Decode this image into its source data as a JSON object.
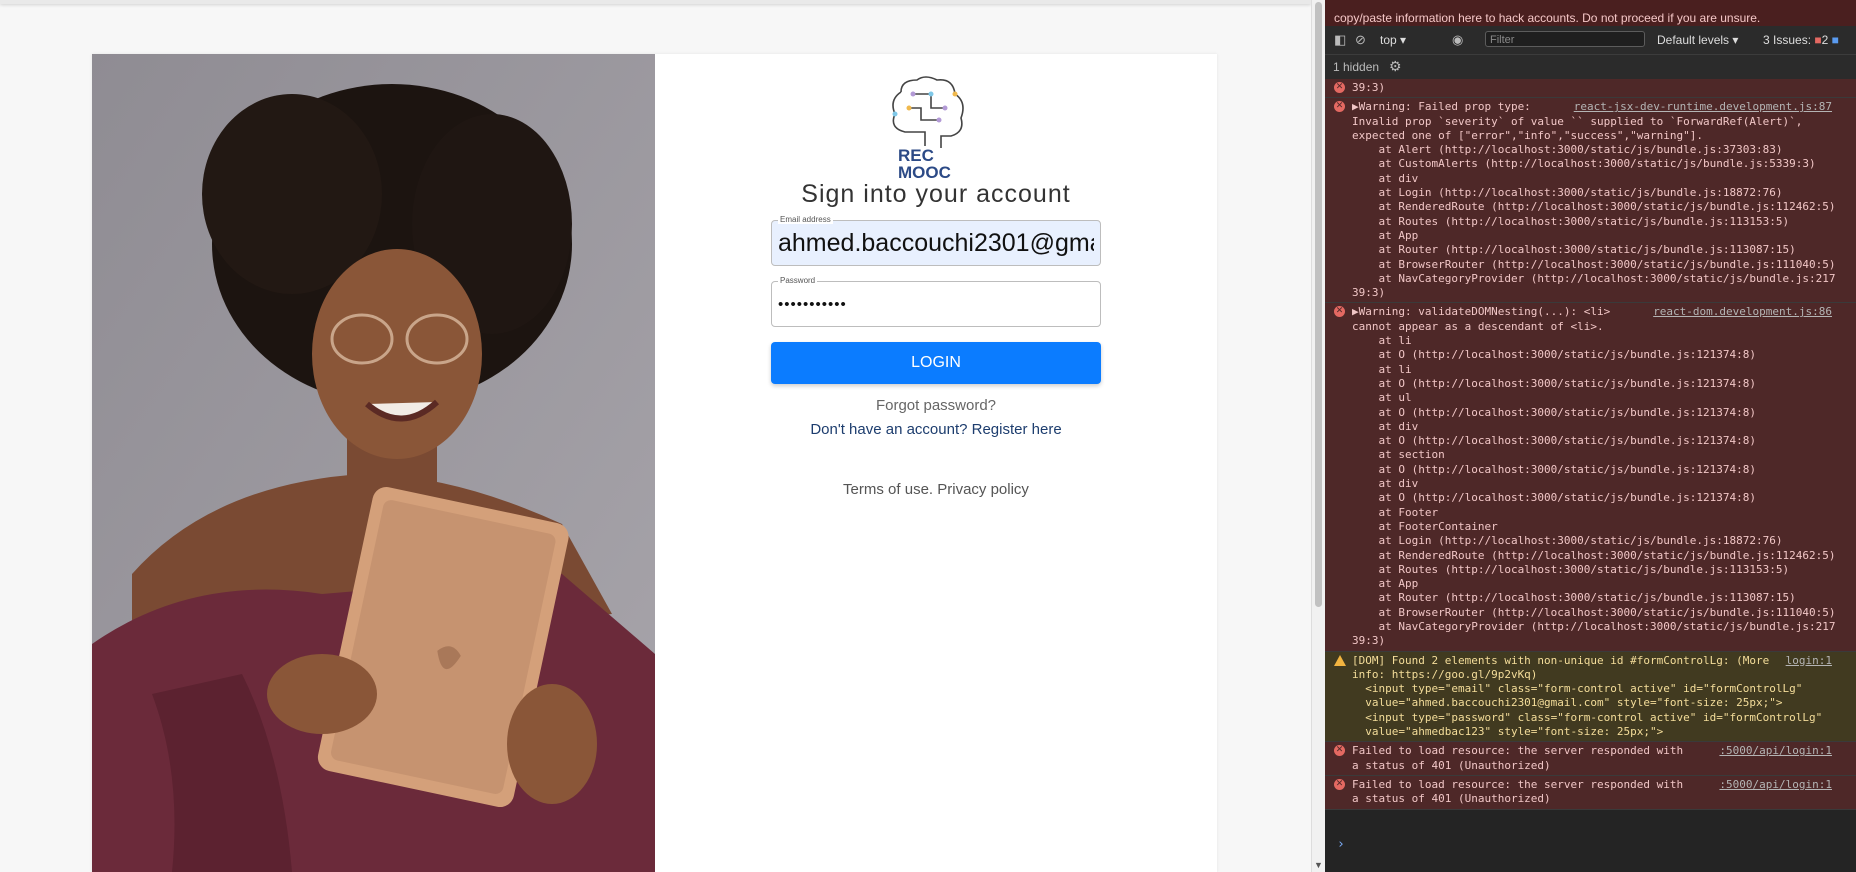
{
  "login": {
    "logo_text_1": "REC",
    "logo_text_2": "MOOC",
    "title": "Sign into your account",
    "email_label": "Email address",
    "email_value": "ahmed.baccouchi2301@gmail.com",
    "password_label": "Password",
    "password_value": "ahmedbac123",
    "login_button": "LOGIN",
    "forgot": "Forgot password?",
    "register": "Don't have an account? Register here",
    "terms": "Terms of use. Privacy policy"
  },
  "devtools": {
    "banner": "copy/paste information here to hack accounts. Do not proceed if you are unsure.",
    "context": "top",
    "filter_placeholder": "Filter",
    "levels": "Default levels",
    "issues": "3 Issues:",
    "issues_err": "2",
    "hidden": "1 hidden",
    "entries": [
      {
        "type": "err",
        "source": "",
        "text": "39:3)"
      },
      {
        "type": "err",
        "source": "react-jsx-dev-runtime.development.js:87",
        "text": "▶Warning: Failed prop type:\nInvalid prop `severity` of value `` supplied to `ForwardRef(Alert)`,\nexpected one of [\"error\",\"info\",\"success\",\"warning\"].\n    at Alert (http://localhost:3000/static/js/bundle.js:37303:83)\n    at CustomAlerts (http://localhost:3000/static/js/bundle.js:5339:3)\n    at div\n    at Login (http://localhost:3000/static/js/bundle.js:18872:76)\n    at RenderedRoute (http://localhost:3000/static/js/bundle.js:112462:5)\n    at Routes (http://localhost:3000/static/js/bundle.js:113153:5)\n    at App\n    at Router (http://localhost:3000/static/js/bundle.js:113087:15)\n    at BrowserRouter (http://localhost:3000/static/js/bundle.js:111040:5)\n    at NavCategoryProvider (http://localhost:3000/static/js/bundle.js:217\n39:3)"
      },
      {
        "type": "err",
        "source": "react-dom.development.js:86",
        "text": "▶Warning: validateDOMNesting(...): <li>\ncannot appear as a descendant of <li>.\n    at li\n    at O (http://localhost:3000/static/js/bundle.js:121374:8)\n    at li\n    at O (http://localhost:3000/static/js/bundle.js:121374:8)\n    at ul\n    at O (http://localhost:3000/static/js/bundle.js:121374:8)\n    at div\n    at O (http://localhost:3000/static/js/bundle.js:121374:8)\n    at section\n    at O (http://localhost:3000/static/js/bundle.js:121374:8)\n    at div\n    at O (http://localhost:3000/static/js/bundle.js:121374:8)\n    at Footer\n    at FooterContainer\n    at Login (http://localhost:3000/static/js/bundle.js:18872:76)\n    at RenderedRoute (http://localhost:3000/static/js/bundle.js:112462:5)\n    at Routes (http://localhost:3000/static/js/bundle.js:113153:5)\n    at App\n    at Router (http://localhost:3000/static/js/bundle.js:113087:15)\n    at BrowserRouter (http://localhost:3000/static/js/bundle.js:111040:5)\n    at NavCategoryProvider (http://localhost:3000/static/js/bundle.js:217\n39:3)"
      },
      {
        "type": "warn",
        "source": "login:1",
        "text": "[DOM] Found 2 elements with non-unique id #formControlLg: (More\ninfo: https://goo.gl/9p2vKq)\n  <input type=\"email\" class=\"form-control active\" id=\"formControlLg\"\n  value=\"ahmed.baccouchi2301@gmail.com\" style=\"font-size: 25px;\">\n  <input type=\"password\" class=\"form-control active\" id=\"formControlLg\"\n  value=\"ahmedbac123\" style=\"font-size: 25px;\">"
      },
      {
        "type": "err",
        "source": ":5000/api/login:1",
        "text": "Failed to load resource: the server responded with\na status of 401 (Unauthorized)"
      },
      {
        "type": "err",
        "source": ":5000/api/login:1",
        "text": "Failed to load resource: the server responded with\na status of 401 (Unauthorized)"
      }
    ]
  }
}
